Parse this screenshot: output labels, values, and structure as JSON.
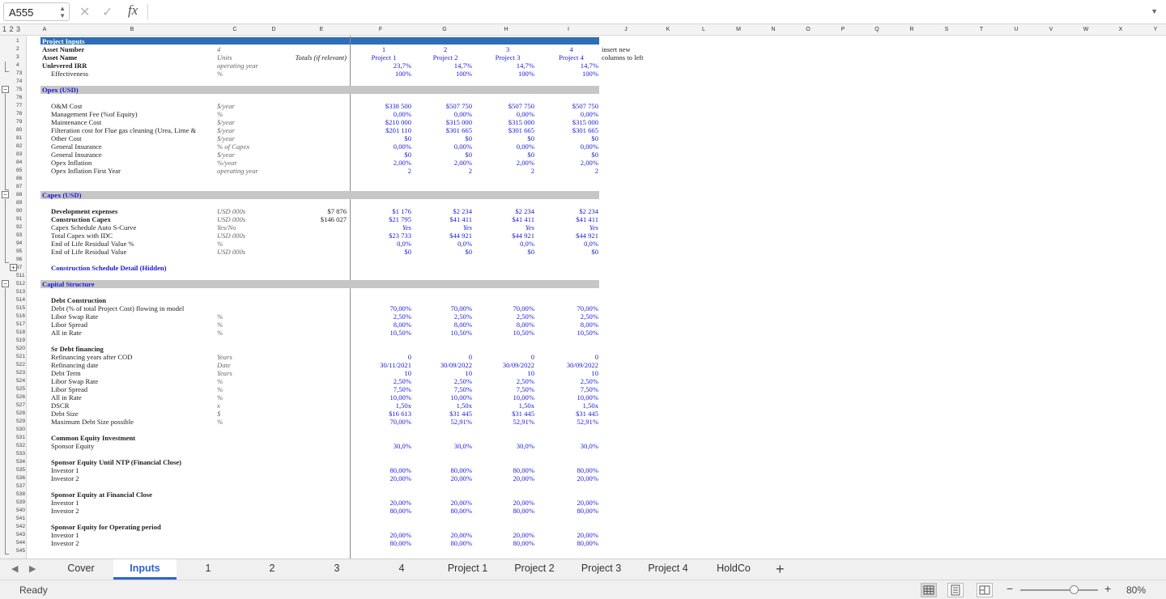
{
  "formula_bar": {
    "name_box": "A555",
    "fx": "fx",
    "formula": ""
  },
  "outline_levels": "1 2 3",
  "columns": [
    "A",
    "B",
    "C",
    "D",
    "E",
    "F",
    "G",
    "H",
    "I",
    "J",
    "K",
    "L",
    "M",
    "N",
    "O",
    "P",
    "Q",
    "R",
    "S",
    "T",
    "U",
    "V",
    "W",
    "X",
    "Y"
  ],
  "rows": [
    {
      "n": "1",
      "a": "Project Inputs",
      "a_style": "bold",
      "band": true
    },
    {
      "n": "2",
      "a": "Asset Number",
      "a_style": "bold",
      "c": "4",
      "f": "1",
      "g": "2",
      "h": "3",
      "i": "4",
      "j": "insert new"
    },
    {
      "n": "3",
      "a": "Asset Name",
      "a_style": "bold",
      "c": "Units",
      "c_style": "ital gray",
      "e": "Totals (if relevant)",
      "f": "Project 1",
      "g": "Project 2",
      "h": "Project 3",
      "i": "Project 4",
      "j": "columns to left"
    },
    {
      "n": "4",
      "a": "Unlevered IRR",
      "a_style": "bold",
      "c": "operating year",
      "f": "23,7%",
      "g": "14,7%",
      "h": "14,7%",
      "i": "14,7%"
    },
    {
      "n": "73",
      "b": "Effectiveness",
      "c": "%",
      "f": "100%",
      "g": "100%",
      "h": "100%",
      "i": "100%"
    },
    {
      "n": "74"
    },
    {
      "n": "75",
      "a": "Opex (USD)",
      "sec": true
    },
    {
      "n": "76"
    },
    {
      "n": "77",
      "b": "O&M Cost",
      "c": "$/year",
      "f": "$338 500",
      "g": "$507 750",
      "h": "$507 750",
      "i": "$507 750"
    },
    {
      "n": "78",
      "b": "Management Fee (%of Equity)",
      "c": "%",
      "f": "0,00%",
      "g": "0,00%",
      "h": "0,00%",
      "i": "0,00%"
    },
    {
      "n": "79",
      "b": "Maintenance Cost",
      "c": "$/year",
      "f": "$210 000",
      "g": "$315 000",
      "h": "$315 000",
      "i": "$315 000"
    },
    {
      "n": "80",
      "b": "Filteration cost for Flue gas cleaning (Urea, Lime &",
      "c": "$/year",
      "f": "$201 110",
      "g": "$301 665",
      "h": "$301 665",
      "i": "$301 665"
    },
    {
      "n": "81",
      "b": "Other Cost",
      "c": "$/year",
      "f": "$0",
      "g": "$0",
      "h": "$0",
      "i": "$0"
    },
    {
      "n": "82",
      "b": "General Insurance",
      "c": "% of Capex",
      "f": "0,00%",
      "g": "0,00%",
      "h": "0,00%",
      "i": "0,00%"
    },
    {
      "n": "83",
      "b": "General Insurance",
      "c": "$/year",
      "f": "$0",
      "g": "$0",
      "h": "$0",
      "i": "$0"
    },
    {
      "n": "84",
      "b": "Opex Inflation",
      "c": "%/year",
      "f": "2,00%",
      "g": "2,00%",
      "h": "2,00%",
      "i": "2,00%"
    },
    {
      "n": "85",
      "b": "Opex Inflation First Year",
      "c": "operating year",
      "f": "2",
      "g": "2",
      "h": "2",
      "i": "2"
    },
    {
      "n": "86"
    },
    {
      "n": "87"
    },
    {
      "n": "88",
      "a": "Capex (USD)",
      "sec": true
    },
    {
      "n": "89"
    },
    {
      "n": "90",
      "b": "Development expenses",
      "b_style": "bold",
      "c": "USD 000s",
      "e": "$7 876",
      "f": "$1 176",
      "g": "$2 234",
      "h": "$2 234",
      "i": "$2 234"
    },
    {
      "n": "91",
      "b": "Construction Capex",
      "b_style": "bold",
      "c": "USD 000s",
      "e": "$146 027",
      "f": "$21 795",
      "g": "$41 411",
      "h": "$41 411",
      "i": "$41 411"
    },
    {
      "n": "92",
      "b": "Capex Schedule Auto S-Curve",
      "c": "Yes/No",
      "f": "Yes",
      "g": "Yes",
      "h": "Yes",
      "i": "Yes"
    },
    {
      "n": "93",
      "b": "Total Capex with IDC",
      "c": "USD 000s",
      "f": "$23 733",
      "g": "$44 921",
      "h": "$44 921",
      "i": "$44 921"
    },
    {
      "n": "94",
      "b": "End of Life Residual Value %",
      "c": "%",
      "f": "0,0%",
      "g": "0,0%",
      "h": "0,0%",
      "i": "0,0%"
    },
    {
      "n": "95",
      "b": "End of Life Residual Value",
      "c": "USD 000s",
      "f": "$0",
      "g": "$0",
      "h": "$0",
      "i": "$0"
    },
    {
      "n": "96"
    },
    {
      "n": "97",
      "b": "Construction Schedule Detail (Hidden)",
      "b_style": "bold blue"
    },
    {
      "n": "511"
    },
    {
      "n": "512",
      "a": "Capital Structure",
      "sec": true
    },
    {
      "n": "513"
    },
    {
      "n": "514",
      "b": "Debt Construction",
      "b_style": "bold"
    },
    {
      "n": "515",
      "b": "  Debt (% of total Project Cost) flowing in model",
      "f": "70,00%",
      "g": "70,00%",
      "h": "70,00%",
      "i": "70,00%"
    },
    {
      "n": "516",
      "b": "  Libor Swap Rate",
      "c": "%",
      "f": "2,50%",
      "g": "2,50%",
      "h": "2,50%",
      "i": "2,50%"
    },
    {
      "n": "517",
      "b": "  Libor Spread",
      "c": "%",
      "f": "8,00%",
      "g": "8,00%",
      "h": "8,00%",
      "i": "8,00%"
    },
    {
      "n": "518",
      "b": "  All in Rate",
      "c": "%",
      "f": "10,50%",
      "g": "10,50%",
      "h": "10,50%",
      "i": "10,50%"
    },
    {
      "n": "519"
    },
    {
      "n": "520",
      "b": "Sr Debt financing",
      "b_style": "bold"
    },
    {
      "n": "521",
      "b": "  Refinancing years after COD",
      "c": "Years",
      "f": "0",
      "g": "0",
      "h": "0",
      "i": "0"
    },
    {
      "n": "522",
      "b": "  Refinancing date",
      "c": "Date",
      "f": "30/11/2021",
      "g": "30/09/2022",
      "h": "30/09/2022",
      "i": "30/09/2022"
    },
    {
      "n": "523",
      "b": "  Debt Term",
      "c": "Years",
      "f": "10",
      "g": "10",
      "h": "10",
      "i": "10"
    },
    {
      "n": "524",
      "b": "  Libor Swap Rate",
      "c": "%",
      "f": "2,50%",
      "g": "2,50%",
      "h": "2,50%",
      "i": "2,50%"
    },
    {
      "n": "525",
      "b": "  Libor Spread",
      "c": "%",
      "f": "7,50%",
      "g": "7,50%",
      "h": "7,50%",
      "i": "7,50%"
    },
    {
      "n": "526",
      "b": "  All in Rate",
      "c": "%",
      "f": "10,00%",
      "g": "10,00%",
      "h": "10,00%",
      "i": "10,00%"
    },
    {
      "n": "527",
      "b": "  DSCR",
      "c": "x",
      "f": "1,50x",
      "g": "1,50x",
      "h": "1,50x",
      "i": "1,50x"
    },
    {
      "n": "528",
      "b": "  Debt Size",
      "c": "$",
      "f": "$16 613",
      "g": "$31 445",
      "h": "$31 445",
      "i": "$31 445"
    },
    {
      "n": "529",
      "b": "  Maximum Debt Size possible",
      "c": "%",
      "f": "70,00%",
      "g": "52,91%",
      "h": "52,91%",
      "i": "52,91%"
    },
    {
      "n": "530"
    },
    {
      "n": "531",
      "b": "Common Equity Investment",
      "b_style": "bold"
    },
    {
      "n": "532",
      "b": "  Sponsor Equity",
      "f": "30,0%",
      "g": "30,0%",
      "h": "30,0%",
      "i": "30,0%"
    },
    {
      "n": "533"
    },
    {
      "n": "534",
      "b": "Sponsor Equity Until NTP (Financial Close)",
      "b_style": "bold"
    },
    {
      "n": "535",
      "b": "  Investor 1",
      "f": "80,00%",
      "g": "80,00%",
      "h": "80,00%",
      "i": "80,00%"
    },
    {
      "n": "536",
      "b": "  Investor 2",
      "f": "20,00%",
      "g": "20,00%",
      "h": "20,00%",
      "i": "20,00%"
    },
    {
      "n": "537"
    },
    {
      "n": "538",
      "b": "Sponsor Equity at Financial Close",
      "b_style": "bold"
    },
    {
      "n": "539",
      "b": "  Investor 1",
      "f": "20,00%",
      "g": "20,00%",
      "h": "20,00%",
      "i": "20,00%"
    },
    {
      "n": "540",
      "b": "  Investor 2",
      "f": "80,00%",
      "g": "80,00%",
      "h": "80,00%",
      "i": "80,00%"
    },
    {
      "n": "541"
    },
    {
      "n": "542",
      "b": "Sponsor Equity for Operating period",
      "b_style": "bold"
    },
    {
      "n": "543",
      "b": "  Investor 1",
      "f": "20,00%",
      "g": "20,00%",
      "h": "20,00%",
      "i": "20,00%"
    },
    {
      "n": "544",
      "b": "  Investor 2",
      "f": "80,00%",
      "g": "80,00%",
      "h": "80,00%",
      "i": "80,00%"
    },
    {
      "n": "545"
    }
  ],
  "sheet_tabs": [
    "Cover",
    "Inputs",
    "1",
    "2",
    "3",
    "4",
    "Project 1",
    "Project 2",
    "Project 3",
    "Project 4",
    "HoldCo"
  ],
  "active_tab": "Inputs",
  "status": {
    "ready": "Ready",
    "zoom": "80%",
    "zoom_level_percent": 80
  },
  "colors": {
    "header_band": "#2e6eb8",
    "section_band": "#c6c6c6",
    "input_blue": "#1a1ad6",
    "active_tab": "#2b63d6"
  },
  "icons": {
    "cancel": "close-icon",
    "enter": "checkmark-icon",
    "add_sheet": "plus-icon",
    "prev_sheet": "triangle-left-icon",
    "next_sheet": "triangle-right-icon"
  }
}
